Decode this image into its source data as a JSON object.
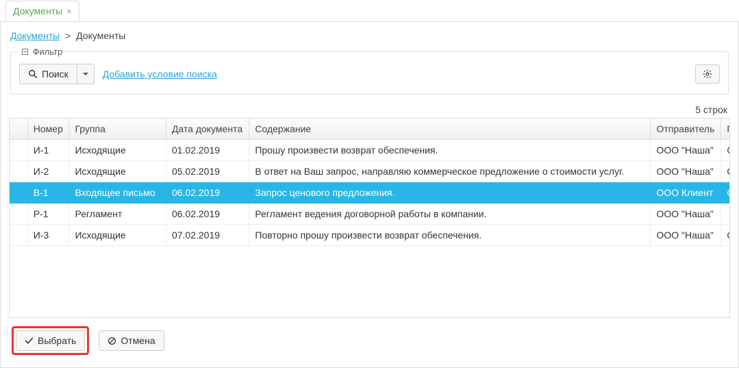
{
  "tab": {
    "label": "Документы"
  },
  "breadcrumb": {
    "root": "Документы",
    "current": "Документы"
  },
  "filter": {
    "legend": "Фильтр",
    "search_label": "Поиск",
    "add_condition": "Добавить условие поиска"
  },
  "count_text": "5 строк",
  "columns": {
    "number": "Номер",
    "group": "Группа",
    "date": "Дата документа",
    "content": "Содержание",
    "sender": "Отправитель",
    "recipient": "Полу"
  },
  "rows": [
    {
      "num": "И-1",
      "group": "Исходящие",
      "date": "01.02.2019",
      "content": "Прошу произвести возврат обеспечения.",
      "sender": "ООО \"Наша\"",
      "recv": "ООС",
      "selected": false
    },
    {
      "num": "И-2",
      "group": "Исходящие",
      "date": "05.02.2019",
      "content": "В ответ на Ваш запрос, направляю коммерческое предложение о стоимости услуг.",
      "sender": "ООО \"Наша\"",
      "recv": "ООС",
      "selected": false
    },
    {
      "num": "В-1",
      "group": "Входящее письмо",
      "date": "06.02.2019",
      "content": "Запрос ценового предложения.",
      "sender": "ООО Клиент",
      "recv": "ООС",
      "selected": true
    },
    {
      "num": "Р-1",
      "group": "Регламент",
      "date": "06.02.2019",
      "content": "Регламент ведения договорной работы в компании.",
      "sender": "ООО \"Наша\"",
      "recv": "",
      "selected": false
    },
    {
      "num": "И-3",
      "group": "Исходящие",
      "date": "07.02.2019",
      "content": "Повторно прошу произвести возврат обеспечения.",
      "sender": "ООО \"Наша\"",
      "recv": "ООС",
      "selected": false
    }
  ],
  "buttons": {
    "select": "Выбрать",
    "cancel": "Отмена"
  }
}
